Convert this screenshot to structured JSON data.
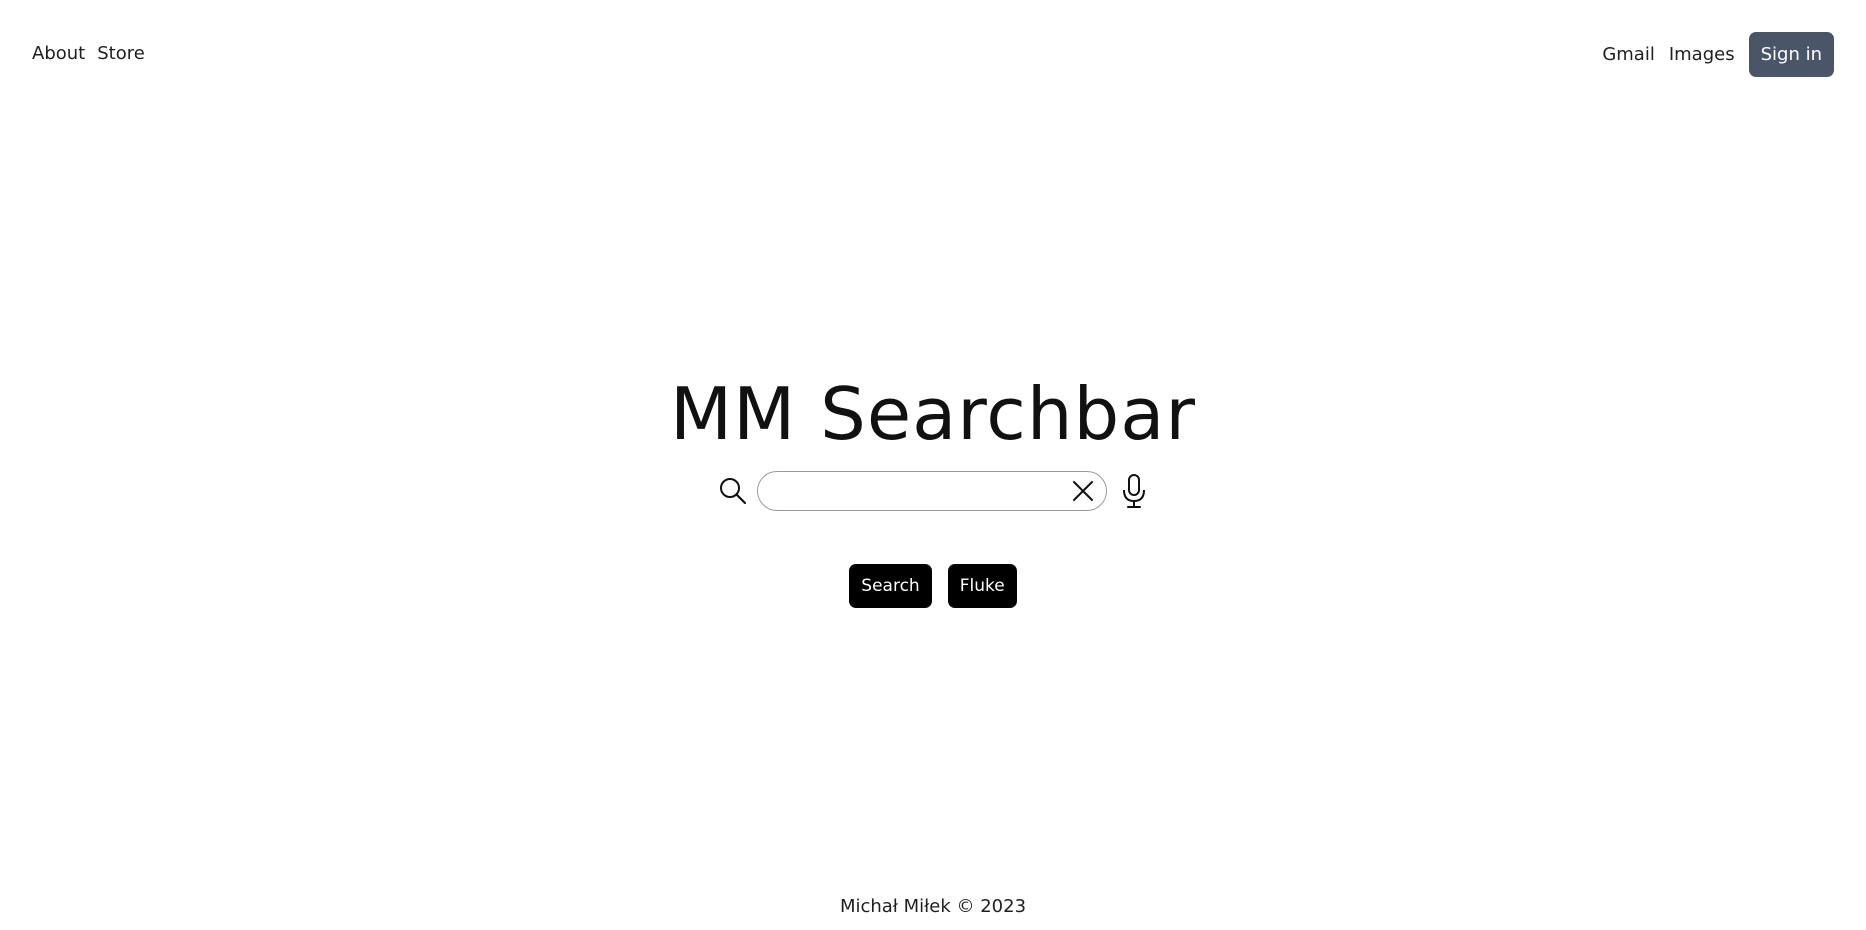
{
  "nav": {
    "left": [
      {
        "label": "About"
      },
      {
        "label": "Store"
      }
    ],
    "right": [
      {
        "label": "Gmail"
      },
      {
        "label": "Images"
      }
    ],
    "signin_label": "Sign in"
  },
  "logo": {
    "text": "MM Searchbar"
  },
  "search": {
    "value": "",
    "placeholder": "",
    "icons": {
      "search": "search-icon",
      "clear": "close-icon",
      "mic": "microphone-icon"
    }
  },
  "buttons": {
    "search_label": "Search",
    "fluke_label": "Fluke"
  },
  "footer": {
    "text": "Michał Miłek © 2023"
  },
  "colors": {
    "signin_bg": "#4a5568",
    "action_bg": "#000000",
    "background": "#ffffff"
  }
}
